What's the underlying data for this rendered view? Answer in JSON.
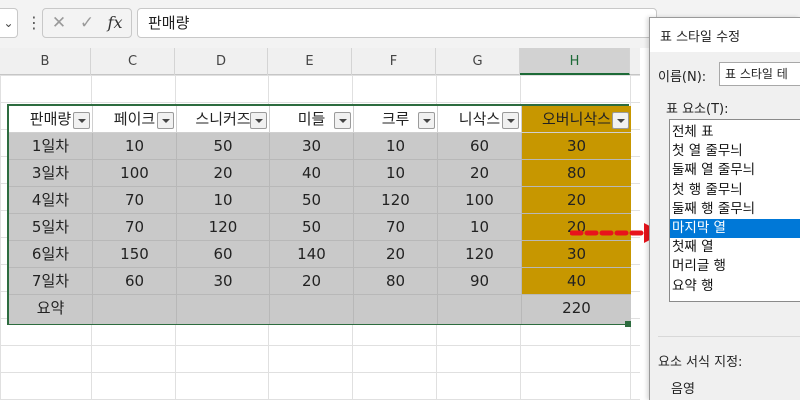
{
  "formula_bar": {
    "chevron": "⌄",
    "more": "⋮",
    "cancel_glyph": "✕",
    "enter_glyph": "✓",
    "fx_label": "fx",
    "content": "판매량"
  },
  "columns": [
    "B",
    "C",
    "D",
    "E",
    "F",
    "G",
    "H"
  ],
  "table": {
    "headers": [
      "판매량",
      "페이크",
      "스니커즈",
      "미들",
      "크루",
      "니삭스",
      "오버니삭스"
    ],
    "rows": [
      [
        "1일차",
        "10",
        "50",
        "30",
        "10",
        "60",
        "30"
      ],
      [
        "3일차",
        "100",
        "20",
        "40",
        "10",
        "20",
        "80"
      ],
      [
        "4일차",
        "70",
        "10",
        "50",
        "120",
        "100",
        "20"
      ],
      [
        "5일차",
        "70",
        "120",
        "50",
        "70",
        "10",
        "20"
      ],
      [
        "6일차",
        "150",
        "60",
        "140",
        "20",
        "120",
        "30"
      ],
      [
        "7일차",
        "60",
        "30",
        "20",
        "80",
        "90",
        "40"
      ]
    ],
    "summary": [
      "요약",
      "",
      "",
      "",
      "",
      "",
      "220"
    ],
    "colors": {
      "last_column": "#c79700",
      "banded": "#c9c9c9",
      "border": "#2d6c3f"
    }
  },
  "dialog": {
    "title": "표 스타일 수정",
    "name_label": "이름(N):",
    "name_value": "표 스타일 테",
    "elements_label": "표 요소(T):",
    "elements": [
      "전체 표",
      "첫 열 줄무늬",
      "둘째 열 줄무늬",
      "첫 행 줄무늬",
      "둘째 행 줄무늬",
      "마지막 열",
      "첫째 열",
      "머리글 행",
      "요약 행"
    ],
    "selected_index": 5,
    "format_label": "요소 서식 지정:",
    "shade_label": "음영"
  },
  "annotation": {
    "arrow_color": "#e8141c"
  }
}
